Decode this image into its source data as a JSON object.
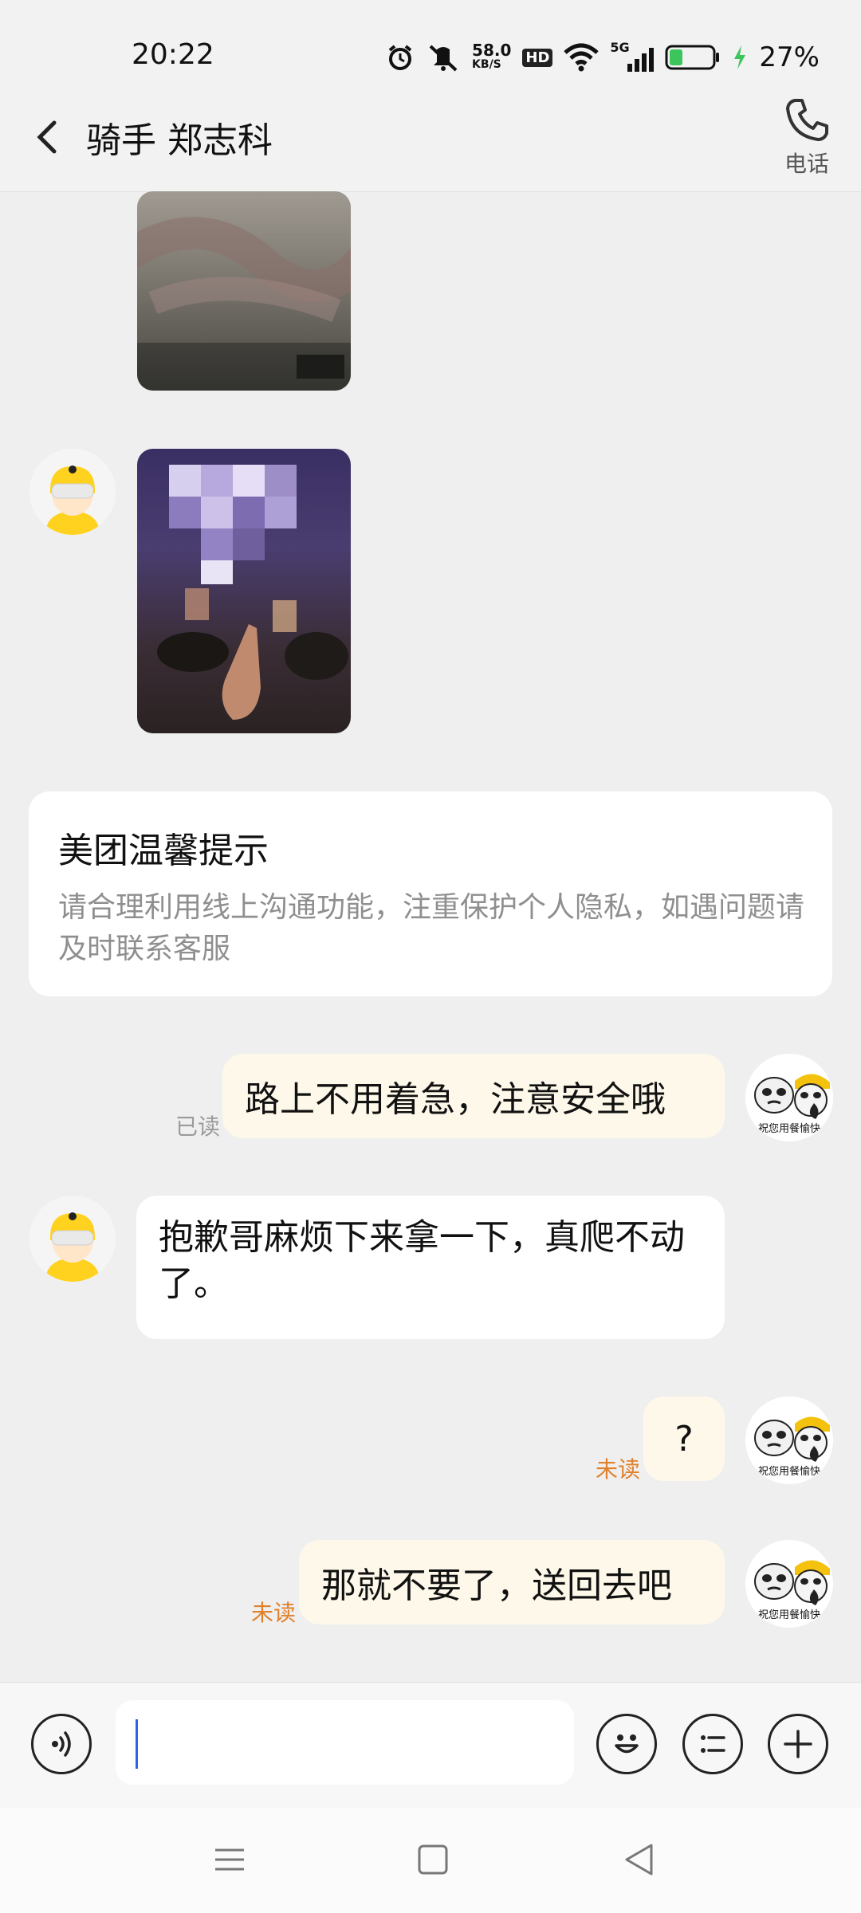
{
  "status_bar": {
    "time": "20:22",
    "net_speed_value": "58.0",
    "net_speed_unit": "KB/S",
    "hd_badge": "HD",
    "network_type": "5G",
    "battery_percent": "27%"
  },
  "header": {
    "title": "骑手 郑志科",
    "phone_label": "电话"
  },
  "notice": {
    "title": "美团温馨提示",
    "body": "请合理利用线上沟通功能，注重保护个人隐私，如遇问题请及时联系客服"
  },
  "messages": [
    {
      "text": "路上不用着急，注意安全哦",
      "status": "已读"
    },
    {
      "text": "抱歉哥麻烦下来拿一下，真爬不动了。"
    },
    {
      "text": "?",
      "status": "未读"
    },
    {
      "text": "那就不要了，送回去吧",
      "status": "未读"
    }
  ],
  "me_avatar_caption": "祝您用餐愉快",
  "colors": {
    "my_bubble": "#fdf8e9",
    "other_bubble": "#ffffff",
    "unread": "#e0802a",
    "read": "#9a9a9a",
    "caret": "#2c64e8",
    "battery_fill": "#3cc55a"
  },
  "icons": [
    "back-icon",
    "phone-icon",
    "voice-icon",
    "emoji-icon",
    "quick-reply-icon",
    "plus-icon",
    "menu-nav-icon",
    "home-nav-icon",
    "back-nav-icon"
  ]
}
